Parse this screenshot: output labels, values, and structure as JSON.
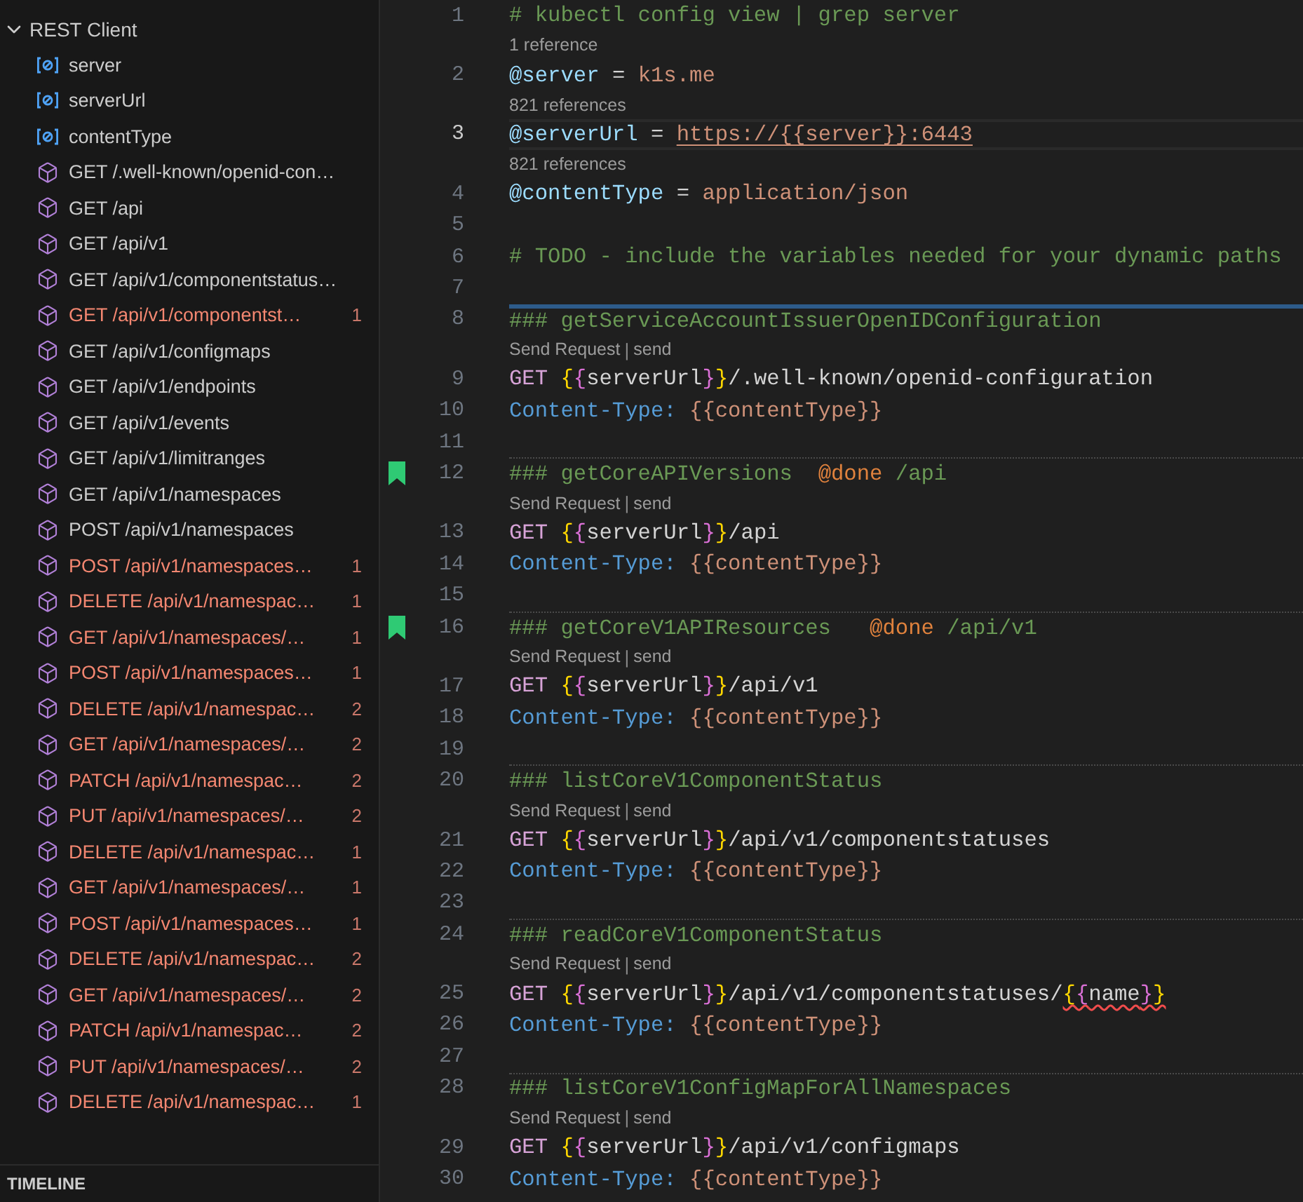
{
  "sidebar": {
    "section": {
      "title": "REST Client",
      "expanded": true
    },
    "items": [
      {
        "kind": "variable",
        "label": "server",
        "error": false
      },
      {
        "kind": "variable",
        "label": "serverUrl",
        "error": false
      },
      {
        "kind": "variable",
        "label": "contentType",
        "error": false
      },
      {
        "kind": "request",
        "label": "GET /.well-known/openid-con…",
        "error": false
      },
      {
        "kind": "request",
        "label": "GET /api",
        "error": false
      },
      {
        "kind": "request",
        "label": "GET /api/v1",
        "error": false
      },
      {
        "kind": "request",
        "label": "GET /api/v1/componentstatus…",
        "error": false
      },
      {
        "kind": "request",
        "label": "GET /api/v1/componentst…",
        "error": true,
        "count": "1"
      },
      {
        "kind": "request",
        "label": "GET /api/v1/configmaps",
        "error": false
      },
      {
        "kind": "request",
        "label": "GET /api/v1/endpoints",
        "error": false
      },
      {
        "kind": "request",
        "label": "GET /api/v1/events",
        "error": false
      },
      {
        "kind": "request",
        "label": "GET /api/v1/limitranges",
        "error": false
      },
      {
        "kind": "request",
        "label": "GET /api/v1/namespaces",
        "error": false
      },
      {
        "kind": "request",
        "label": "POST /api/v1/namespaces",
        "error": false
      },
      {
        "kind": "request",
        "label": "POST /api/v1/namespaces…",
        "error": true,
        "count": "1"
      },
      {
        "kind": "request",
        "label": "DELETE /api/v1/namespac…",
        "error": true,
        "count": "1"
      },
      {
        "kind": "request",
        "label": "GET /api/v1/namespaces/…",
        "error": true,
        "count": "1"
      },
      {
        "kind": "request",
        "label": "POST /api/v1/namespaces…",
        "error": true,
        "count": "1"
      },
      {
        "kind": "request",
        "label": "DELETE /api/v1/namespac…",
        "error": true,
        "count": "2"
      },
      {
        "kind": "request",
        "label": "GET /api/v1/namespaces/…",
        "error": true,
        "count": "2"
      },
      {
        "kind": "request",
        "label": "PATCH /api/v1/namespac…",
        "error": true,
        "count": "2"
      },
      {
        "kind": "request",
        "label": "PUT /api/v1/namespaces/…",
        "error": true,
        "count": "2"
      },
      {
        "kind": "request",
        "label": "DELETE /api/v1/namespac…",
        "error": true,
        "count": "1"
      },
      {
        "kind": "request",
        "label": "GET /api/v1/namespaces/…",
        "error": true,
        "count": "1"
      },
      {
        "kind": "request",
        "label": "POST /api/v1/namespaces…",
        "error": true,
        "count": "1"
      },
      {
        "kind": "request",
        "label": "DELETE /api/v1/namespac…",
        "error": true,
        "count": "2"
      },
      {
        "kind": "request",
        "label": "GET /api/v1/namespaces/…",
        "error": true,
        "count": "2"
      },
      {
        "kind": "request",
        "label": "PATCH /api/v1/namespac…",
        "error": true,
        "count": "2"
      },
      {
        "kind": "request",
        "label": "PUT /api/v1/namespaces/…",
        "error": true,
        "count": "2"
      },
      {
        "kind": "request",
        "label": "DELETE /api/v1/namespac…",
        "error": true,
        "count": "1"
      }
    ],
    "footer": "TIMELINE"
  },
  "editor": {
    "lines": [
      {
        "number": "1",
        "current": false,
        "bookmarked": false,
        "tokens": [
          {
            "kind": "comment",
            "text": "# kubectl config view | grep server"
          }
        ]
      },
      {
        "number": "2",
        "current": false,
        "bookmarked": false,
        "lens": [
          {
            "kind": "link",
            "text": "1 reference"
          }
        ],
        "tokens": [
          {
            "kind": "variable",
            "text": "@server"
          },
          {
            "kind": "operator",
            "text": " = "
          },
          {
            "kind": "value",
            "text": "k1s.me"
          }
        ]
      },
      {
        "number": "3",
        "current": true,
        "bookmarked": false,
        "lens": [
          {
            "kind": "link",
            "text": "821 references"
          }
        ],
        "tokens": [
          {
            "kind": "variable",
            "text": "@serverUrl"
          },
          {
            "kind": "operator",
            "text": " = "
          },
          {
            "kind": "link",
            "text": "https://{{server}}:6443"
          }
        ]
      },
      {
        "number": "4",
        "current": false,
        "bookmarked": false,
        "lens": [
          {
            "kind": "link",
            "text": "821 references"
          }
        ],
        "tokens": [
          {
            "kind": "variable",
            "text": "@contentType"
          },
          {
            "kind": "operator",
            "text": " = "
          },
          {
            "kind": "value",
            "text": "application/json"
          }
        ]
      },
      {
        "number": "5",
        "current": false,
        "bookmarked": false
      },
      {
        "number": "6",
        "current": false,
        "bookmarked": false,
        "tokens": [
          {
            "kind": "comment",
            "text": "# TODO - include the variables needed for your dynamic paths"
          }
        ]
      },
      {
        "number": "7",
        "current": false,
        "bookmarked": false
      },
      {
        "number": "8",
        "current": false,
        "bookmarked": false,
        "section_start": true,
        "focused": true,
        "tokens": [
          {
            "kind": "heading",
            "text": "### getServiceAccountIssuerOpenIDConfiguration"
          }
        ]
      },
      {
        "number": "9",
        "current": false,
        "bookmarked": false,
        "lens": [
          {
            "kind": "link",
            "text": "Send Request"
          },
          {
            "kind": "separator",
            "text": "|"
          },
          {
            "kind": "link",
            "text": "send"
          }
        ],
        "tokens": [
          {
            "kind": "method",
            "text": "GET "
          },
          {
            "kind": "brace_outer",
            "text": "{"
          },
          {
            "kind": "brace_inner",
            "text": "{"
          },
          {
            "kind": "plain",
            "text": "serverUrl"
          },
          {
            "kind": "brace_inner",
            "text": "}"
          },
          {
            "kind": "brace_outer",
            "text": "}"
          },
          {
            "kind": "plain",
            "text": "/.well-known/openid-configuration"
          }
        ]
      },
      {
        "number": "10",
        "current": false,
        "bookmarked": false,
        "tokens": [
          {
            "kind": "header",
            "text": "Content-Type: "
          },
          {
            "kind": "value",
            "text": "{{contentType}}"
          }
        ]
      },
      {
        "number": "11",
        "current": false,
        "bookmarked": false
      },
      {
        "number": "12",
        "current": false,
        "bookmarked": true,
        "section_start": true,
        "focused": false,
        "tokens": [
          {
            "kind": "heading",
            "text": "### getCoreAPIVersions  "
          },
          {
            "kind": "tag",
            "text": "@done"
          },
          {
            "kind": "heading",
            "text": " /api"
          }
        ]
      },
      {
        "number": "13",
        "current": false,
        "bookmarked": false,
        "lens": [
          {
            "kind": "link",
            "text": "Send Request"
          },
          {
            "kind": "separator",
            "text": "|"
          },
          {
            "kind": "link",
            "text": "send"
          }
        ],
        "tokens": [
          {
            "kind": "method",
            "text": "GET "
          },
          {
            "kind": "brace_outer",
            "text": "{"
          },
          {
            "kind": "brace_inner",
            "text": "{"
          },
          {
            "kind": "plain",
            "text": "serverUrl"
          },
          {
            "kind": "brace_inner",
            "text": "}"
          },
          {
            "kind": "brace_outer",
            "text": "}"
          },
          {
            "kind": "plain",
            "text": "/api"
          }
        ]
      },
      {
        "number": "14",
        "current": false,
        "bookmarked": false,
        "tokens": [
          {
            "kind": "header",
            "text": "Content-Type: "
          },
          {
            "kind": "value",
            "text": "{{contentType}}"
          }
        ]
      },
      {
        "number": "15",
        "current": false,
        "bookmarked": false
      },
      {
        "number": "16",
        "current": false,
        "bookmarked": true,
        "section_start": true,
        "focused": false,
        "tokens": [
          {
            "kind": "heading",
            "text": "### getCoreV1APIResources   "
          },
          {
            "kind": "tag",
            "text": "@done"
          },
          {
            "kind": "heading",
            "text": " /api/v1"
          }
        ]
      },
      {
        "number": "17",
        "current": false,
        "bookmarked": false,
        "lens": [
          {
            "kind": "link",
            "text": "Send Request"
          },
          {
            "kind": "separator",
            "text": "|"
          },
          {
            "kind": "link",
            "text": "send"
          }
        ],
        "tokens": [
          {
            "kind": "method",
            "text": "GET "
          },
          {
            "kind": "brace_outer",
            "text": "{"
          },
          {
            "kind": "brace_inner",
            "text": "{"
          },
          {
            "kind": "plain",
            "text": "serverUrl"
          },
          {
            "kind": "brace_inner",
            "text": "}"
          },
          {
            "kind": "brace_outer",
            "text": "}"
          },
          {
            "kind": "plain",
            "text": "/api/v1"
          }
        ]
      },
      {
        "number": "18",
        "current": false,
        "bookmarked": false,
        "tokens": [
          {
            "kind": "header",
            "text": "Content-Type: "
          },
          {
            "kind": "value",
            "text": "{{contentType}}"
          }
        ]
      },
      {
        "number": "19",
        "current": false,
        "bookmarked": false
      },
      {
        "number": "20",
        "current": false,
        "bookmarked": false,
        "section_start": true,
        "focused": false,
        "tokens": [
          {
            "kind": "heading",
            "text": "### listCoreV1ComponentStatus"
          }
        ]
      },
      {
        "number": "21",
        "current": false,
        "bookmarked": false,
        "lens": [
          {
            "kind": "link",
            "text": "Send Request"
          },
          {
            "kind": "separator",
            "text": "|"
          },
          {
            "kind": "link",
            "text": "send"
          }
        ],
        "tokens": [
          {
            "kind": "method",
            "text": "GET "
          },
          {
            "kind": "brace_outer",
            "text": "{"
          },
          {
            "kind": "brace_inner",
            "text": "{"
          },
          {
            "kind": "plain",
            "text": "serverUrl"
          },
          {
            "kind": "brace_inner",
            "text": "}"
          },
          {
            "kind": "brace_outer",
            "text": "}"
          },
          {
            "kind": "plain",
            "text": "/api/v1/componentstatuses"
          }
        ]
      },
      {
        "number": "22",
        "current": false,
        "bookmarked": false,
        "tokens": [
          {
            "kind": "header",
            "text": "Content-Type: "
          },
          {
            "kind": "value",
            "text": "{{contentType}}"
          }
        ]
      },
      {
        "number": "23",
        "current": false,
        "bookmarked": false
      },
      {
        "number": "24",
        "current": false,
        "bookmarked": false,
        "section_start": true,
        "focused": false,
        "tokens": [
          {
            "kind": "heading",
            "text": "### readCoreV1ComponentStatus"
          }
        ]
      },
      {
        "number": "25",
        "current": false,
        "bookmarked": false,
        "lens": [
          {
            "kind": "link",
            "text": "Send Request"
          },
          {
            "kind": "separator",
            "text": "|"
          },
          {
            "kind": "link",
            "text": "send"
          }
        ],
        "tokens": [
          {
            "kind": "method",
            "text": "GET "
          },
          {
            "kind": "brace_outer",
            "text": "{"
          },
          {
            "kind": "brace_inner",
            "text": "{"
          },
          {
            "kind": "plain",
            "text": "serverUrl"
          },
          {
            "kind": "brace_inner",
            "text": "}"
          },
          {
            "kind": "brace_outer",
            "text": "}"
          },
          {
            "kind": "plain",
            "text": "/api/v1/componentstatuses/"
          },
          {
            "kind": "brace_outer",
            "text": "{",
            "error": true
          },
          {
            "kind": "brace_inner",
            "text": "{",
            "error": true
          },
          {
            "kind": "plain",
            "text": "name",
            "error": true
          },
          {
            "kind": "brace_inner",
            "text": "}",
            "error": true
          },
          {
            "kind": "brace_outer",
            "text": "}",
            "error": true
          }
        ]
      },
      {
        "number": "26",
        "current": false,
        "bookmarked": false,
        "tokens": [
          {
            "kind": "header",
            "text": "Content-Type: "
          },
          {
            "kind": "value",
            "text": "{{contentType}}"
          }
        ]
      },
      {
        "number": "27",
        "current": false,
        "bookmarked": false
      },
      {
        "number": "28",
        "current": false,
        "bookmarked": false,
        "section_start": true,
        "focused": false,
        "tokens": [
          {
            "kind": "heading",
            "text": "### listCoreV1ConfigMapForAllNamespaces"
          }
        ]
      },
      {
        "number": "29",
        "current": false,
        "bookmarked": false,
        "lens": [
          {
            "kind": "link",
            "text": "Send Request"
          },
          {
            "kind": "separator",
            "text": "|"
          },
          {
            "kind": "link",
            "text": "send"
          }
        ],
        "tokens": [
          {
            "kind": "method",
            "text": "GET "
          },
          {
            "kind": "brace_outer",
            "text": "{"
          },
          {
            "kind": "brace_inner",
            "text": "{"
          },
          {
            "kind": "plain",
            "text": "serverUrl"
          },
          {
            "kind": "brace_inner",
            "text": "}"
          },
          {
            "kind": "brace_outer",
            "text": "}"
          },
          {
            "kind": "plain",
            "text": "/api/v1/configmaps"
          }
        ]
      },
      {
        "number": "30",
        "current": false,
        "bookmarked": false,
        "tokens": [
          {
            "kind": "header",
            "text": "Content-Type: "
          },
          {
            "kind": "value",
            "text": "{{contentType}}"
          }
        ]
      }
    ]
  }
}
